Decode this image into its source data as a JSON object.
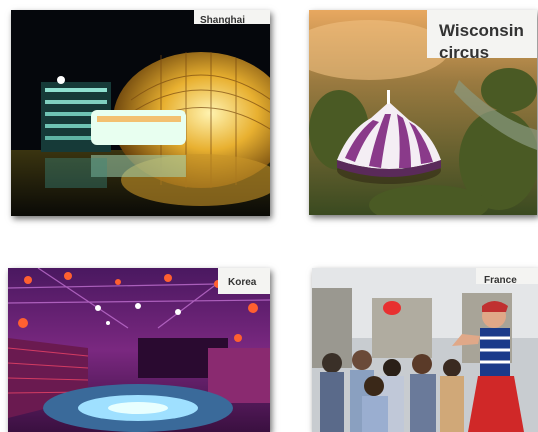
{
  "tiles": [
    {
      "label": "Shanghai"
    },
    {
      "label": "Wisconsin circus"
    },
    {
      "label": "Korea"
    },
    {
      "label": "France"
    }
  ]
}
